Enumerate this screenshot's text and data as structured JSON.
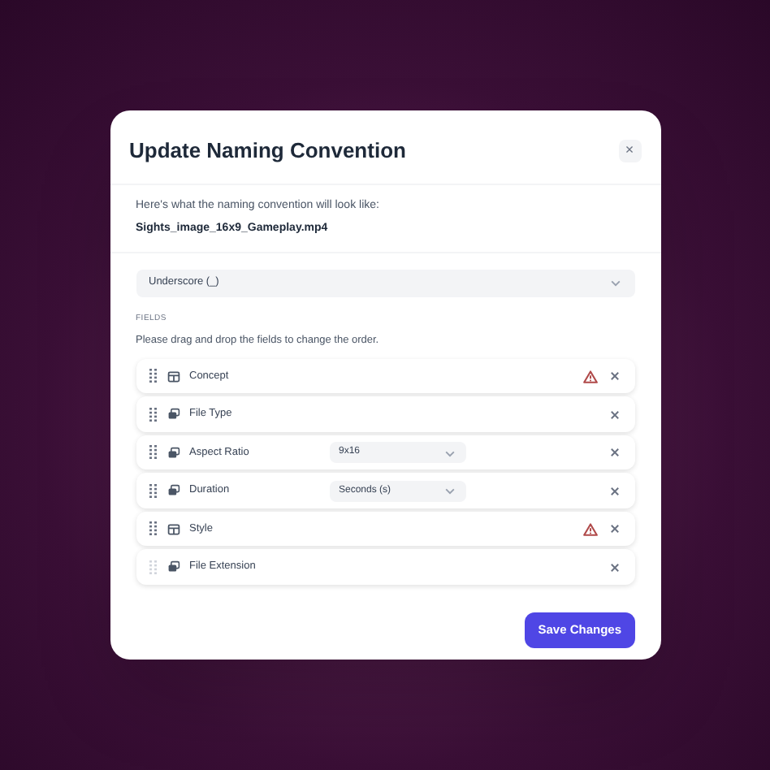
{
  "dialog": {
    "title": "Update Naming Convention",
    "close": "×",
    "preview_label": "Here's what the naming convention will look like:",
    "preview_value": "Sights_image_16x9_Gameplay.mp4",
    "separator": "Underscore (_)",
    "fields_heading": "FIELDS",
    "fields_hint": "Please drag and drop the fields to change the order.",
    "fields": [
      {
        "name": "Concept",
        "kind": "table",
        "warning": true,
        "draggable": true
      },
      {
        "name": "File Type",
        "kind": "layers",
        "warning": false,
        "draggable": true
      },
      {
        "name": "Aspect Ratio",
        "kind": "layers",
        "warning": false,
        "draggable": true,
        "option": "9x16"
      },
      {
        "name": "Duration",
        "kind": "layers",
        "warning": false,
        "draggable": true,
        "option": "Seconds (s)"
      },
      {
        "name": "Style",
        "kind": "table",
        "warning": true,
        "draggable": true
      },
      {
        "name": "File Extension",
        "kind": "layers",
        "warning": false,
        "draggable": false
      }
    ],
    "save": "Save Changes"
  }
}
